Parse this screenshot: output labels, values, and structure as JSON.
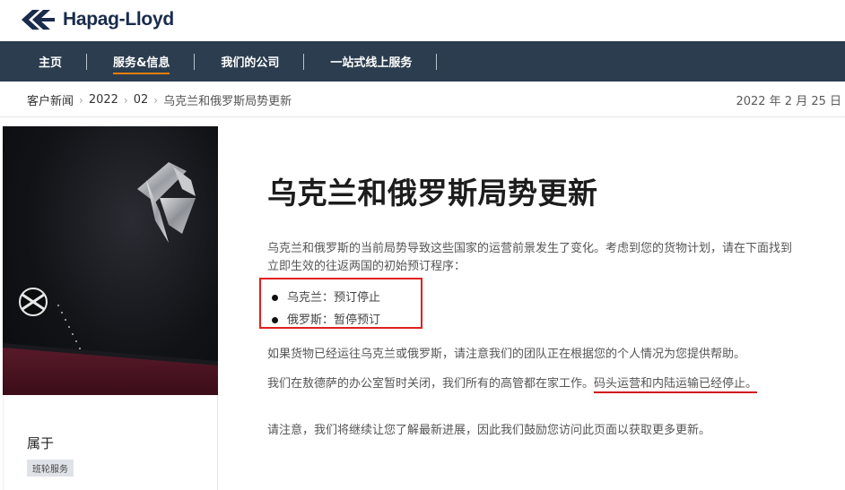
{
  "brand": {
    "name": "Hapag-Lloyd",
    "color": "#1a2b4c"
  },
  "nav": {
    "items": [
      {
        "label": "主页",
        "active": false
      },
      {
        "label": "服务&信息",
        "active": true
      },
      {
        "label": "我们的公司",
        "active": false
      },
      {
        "label": "一站式线上服务",
        "active": false
      }
    ],
    "background": "#2b3d4f",
    "accent": "#f07d00"
  },
  "breadcrumb": [
    "客户新闻",
    "2022",
    "02",
    "乌克兰和俄罗斯局势更新"
  ],
  "date": "2022 年 2 月 25 日",
  "sidebar": {
    "title": "属于",
    "tag": "班轮服务"
  },
  "article": {
    "title": "乌克兰和俄罗斯局势更新",
    "p1": "乌克兰和俄罗斯的当前局势导致这些国家的运营前景发生了变化。考虑到您的货物计划，请在下面找到立即生效的往返两国的初始预订程序：",
    "bullets": [
      "乌克兰：预订停止",
      "俄罗斯：暂停预订"
    ],
    "p2": "如果货物已经运往乌克兰或俄罗斯，请注意我们的团队正在根据您的个人情况为您提供帮助。",
    "p3_start": "我们在敖德萨的办公室暂时关闭，我们所有的高管都在家工作。",
    "p3_highlight": "码头运营和内陆运输已经停止。",
    "p4": "请注意，我们将继续让您了解最新进展，因此我们鼓励您访问此页面以获取更多更新。"
  },
  "annotation_color": "#e02020"
}
